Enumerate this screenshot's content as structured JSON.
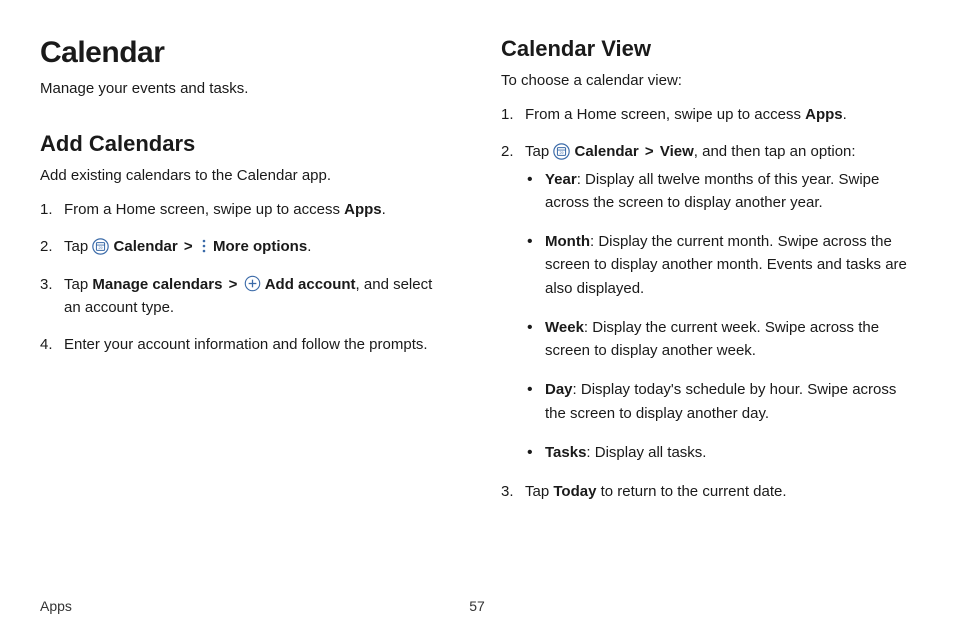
{
  "left": {
    "title": "Calendar",
    "tagline": "Manage your events and tasks.",
    "section_title": "Add Calendars",
    "intro": "Add existing calendars to the Calendar app.",
    "steps": {
      "s1_a": "From a Home screen, swipe up to access ",
      "s1_b": "Apps",
      "s1_c": ".",
      "s2_a": "Tap ",
      "s2_b": "Calendar",
      "s2_c": "More options",
      "s2_d": ".",
      "s3_a": "Tap ",
      "s3_b": "Manage calendars",
      "s3_c": "Add account",
      "s3_d": ", and select an account type.",
      "s4": "Enter your account information and follow the prompts."
    }
  },
  "right": {
    "section_title": "Calendar View",
    "intro": "To choose a calendar view:",
    "steps": {
      "s1_a": "From a Home screen, swipe up to access ",
      "s1_b": "Apps",
      "s1_c": ".",
      "s2_a": "Tap ",
      "s2_b": "Calendar",
      "s2_c": "View",
      "s2_d": ", and then tap an option:",
      "s3_a": "Tap ",
      "s3_b": "Today",
      "s3_c": " to return to the current date."
    },
    "bullets": {
      "b1_a": "Year",
      "b1_b": ": Display all twelve months of this year. Swipe across the screen to display another year.",
      "b2_a": "Month",
      "b2_b": ": Display the current month. Swipe across the screen to display another month. Events and tasks are also displayed.",
      "b3_a": "Week",
      "b3_b": ": Display the current week. Swipe across the screen to display another week.",
      "b4_a": "Day",
      "b4_b": ": Display today's schedule by hour. Swipe across the screen to display another day.",
      "b5_a": "Tasks",
      "b5_b": ": Display all tasks."
    }
  },
  "chevron": ">",
  "footer": {
    "breadcrumb": "Apps",
    "page": "57"
  }
}
